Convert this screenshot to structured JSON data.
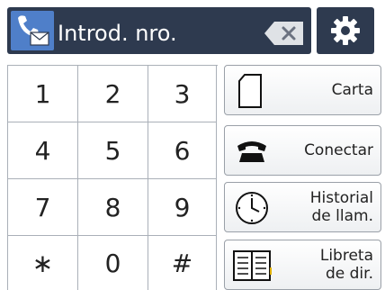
{
  "header": {
    "entry_placeholder": "Introd. nro."
  },
  "keypad": {
    "keys": [
      "1",
      "2",
      "3",
      "4",
      "5",
      "6",
      "7",
      "8",
      "9",
      "∗",
      "0",
      "#"
    ]
  },
  "side_buttons": {
    "carta": "Carta",
    "conectar": "Conectar",
    "historial_line1": "Historial",
    "historial_line2": "de llam.",
    "libreta_line1": "Libreta",
    "libreta_line2": "de dir."
  },
  "icons": {
    "fax": "fax-icon",
    "backspace": "backspace-icon",
    "settings": "gear-icon",
    "carta": "page-icon",
    "conectar": "phone-icon",
    "historial": "clock-icon",
    "libreta": "address-book-icon"
  },
  "colors": {
    "header_bg": "#2e3a4f",
    "fax_icon_bg": "#4f7fc9"
  }
}
